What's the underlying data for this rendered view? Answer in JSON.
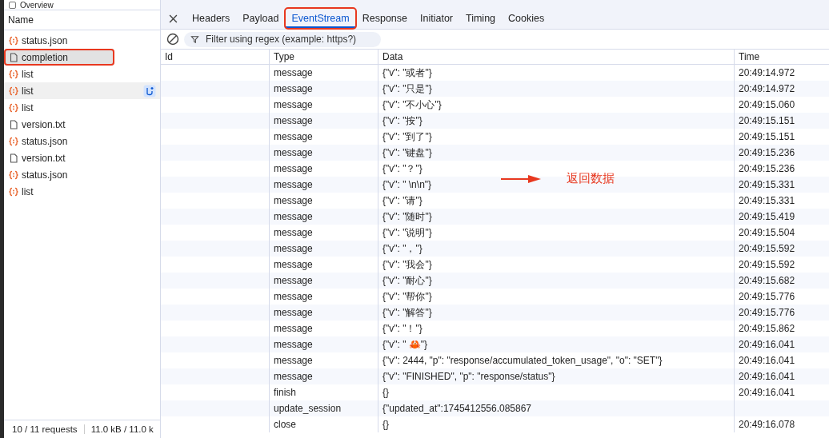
{
  "top_bar": {
    "label": "Overview",
    "checked": false
  },
  "requests": {
    "column": "Name",
    "items": [
      {
        "name": "status.json",
        "kind": "json",
        "selected": false,
        "hovered": false,
        "highlighted": false
      },
      {
        "name": "completion",
        "kind": "doc",
        "selected": true,
        "hovered": false,
        "highlighted": true
      },
      {
        "name": "list",
        "kind": "json",
        "selected": false,
        "hovered": false,
        "highlighted": false
      },
      {
        "name": "list",
        "kind": "json",
        "selected": false,
        "hovered": true,
        "highlighted": false
      },
      {
        "name": "list",
        "kind": "json",
        "selected": false,
        "hovered": false,
        "highlighted": false
      },
      {
        "name": "version.txt",
        "kind": "doc",
        "selected": false,
        "hovered": false,
        "highlighted": false
      },
      {
        "name": "status.json",
        "kind": "json",
        "selected": false,
        "hovered": false,
        "highlighted": false
      },
      {
        "name": "version.txt",
        "kind": "doc",
        "selected": false,
        "hovered": false,
        "highlighted": false
      },
      {
        "name": "status.json",
        "kind": "json",
        "selected": false,
        "hovered": false,
        "highlighted": false
      },
      {
        "name": "list",
        "kind": "json",
        "selected": false,
        "hovered": false,
        "highlighted": false
      }
    ],
    "status": [
      "10 / 11 requests",
      "11.0 kB / 11.0 k"
    ]
  },
  "tabs": [
    {
      "label": "Headers",
      "selected": false,
      "highlighted": false
    },
    {
      "label": "Payload",
      "selected": false,
      "highlighted": false
    },
    {
      "label": "EventStream",
      "selected": true,
      "highlighted": true
    },
    {
      "label": "Response",
      "selected": false,
      "highlighted": false
    },
    {
      "label": "Initiator",
      "selected": false,
      "highlighted": false
    },
    {
      "label": "Timing",
      "selected": false,
      "highlighted": false
    },
    {
      "label": "Cookies",
      "selected": false,
      "highlighted": false
    }
  ],
  "filter": {
    "placeholder": "Filter using regex (example: https?)"
  },
  "table": {
    "columns": [
      "Id",
      "Type",
      "Data",
      "Time"
    ],
    "rows": [
      {
        "type": "message",
        "data": "{\"v\": \"或者\"}",
        "time": "20:49:14.972"
      },
      {
        "type": "message",
        "data": "{\"v\": \"只是\"}",
        "time": "20:49:14.972"
      },
      {
        "type": "message",
        "data": "{\"v\": \"不小心\"}",
        "time": "20:49:15.060"
      },
      {
        "type": "message",
        "data": "{\"v\": \"按\"}",
        "time": "20:49:15.151"
      },
      {
        "type": "message",
        "data": "{\"v\": \"到了\"}",
        "time": "20:49:15.151"
      },
      {
        "type": "message",
        "data": "{\"v\": \"键盘\"}",
        "time": "20:49:15.236"
      },
      {
        "type": "message",
        "data": "{\"v\": \"？\"}",
        "time": "20:49:15.236"
      },
      {
        "type": "message",
        "data": "{\"v\": \" \\n\\n\"}",
        "time": "20:49:15.331"
      },
      {
        "type": "message",
        "data": "{\"v\": \"请\"}",
        "time": "20:49:15.331"
      },
      {
        "type": "message",
        "data": "{\"v\": \"随时\"}",
        "time": "20:49:15.419"
      },
      {
        "type": "message",
        "data": "{\"v\": \"说明\"}",
        "time": "20:49:15.504"
      },
      {
        "type": "message",
        "data": "{\"v\": \"，\"}",
        "time": "20:49:15.592"
      },
      {
        "type": "message",
        "data": "{\"v\": \"我会\"}",
        "time": "20:49:15.592"
      },
      {
        "type": "message",
        "data": "{\"v\": \"耐心\"}",
        "time": "20:49:15.682"
      },
      {
        "type": "message",
        "data": "{\"v\": \"帮你\"}",
        "time": "20:49:15.776"
      },
      {
        "type": "message",
        "data": "{\"v\": \"解答\"}",
        "time": "20:49:15.776"
      },
      {
        "type": "message",
        "data": "{\"v\": \"！\"}",
        "time": "20:49:15.862"
      },
      {
        "type": "message",
        "data": "{\"v\": \" 🦀\"}",
        "time": "20:49:16.041"
      },
      {
        "type": "message",
        "data": "{\"v\": 2444, \"p\": \"response/accumulated_token_usage\", \"o\": \"SET\"}",
        "time": "20:49:16.041"
      },
      {
        "type": "message",
        "data": "{\"v\": \"FINISHED\", \"p\": \"response/status\"}",
        "time": "20:49:16.041"
      },
      {
        "type": "finish",
        "data": "{}",
        "time": "20:49:16.041"
      },
      {
        "type": "update_session",
        "data": "{\"updated_at\":1745412556.085867"
      },
      {
        "type": "close",
        "data": "{}",
        "time": "20:49:16.078"
      }
    ]
  },
  "annotation": {
    "text": "返回数据"
  }
}
